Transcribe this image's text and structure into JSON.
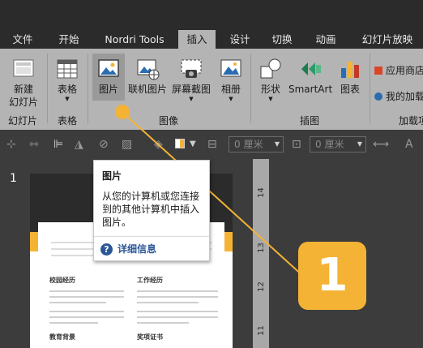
{
  "tabs": [
    {
      "label": "文件"
    },
    {
      "label": "开始"
    },
    {
      "label": "Nordri Tools"
    },
    {
      "label": "插入"
    },
    {
      "label": "设计"
    },
    {
      "label": "切换"
    },
    {
      "label": "动画"
    },
    {
      "label": "幻灯片放映"
    }
  ],
  "ribbon": {
    "new_slide_line1": "新建",
    "new_slide_line2": "幻灯片",
    "table": "表格",
    "picture": "图片",
    "online_picture": "联机图片",
    "screenshot": "屏幕截图",
    "album": "相册",
    "shape": "形状",
    "smartart": "SmartArt",
    "chart": "图表",
    "store": "应用商店",
    "my_addins": "我的加载项"
  },
  "groups": {
    "slides": "幻灯片",
    "tables": "表格",
    "images": "图像",
    "illustrations": "插图",
    "addins": "加载项"
  },
  "format_bar": {
    "width_placeholder": "0 厘米",
    "height_placeholder": "0 厘米"
  },
  "thumbnail": {
    "index": "1"
  },
  "ruler": {
    "labels": [
      "14",
      "13",
      "12",
      "11"
    ]
  },
  "tooltip": {
    "title": "图片",
    "body": "从您的计算机或您连接到的其他计算机中插入图片。",
    "link": "详细信息"
  },
  "slide": {
    "section_education": "校园经历",
    "section_work": "工作经历",
    "section_edu_bg": "教育背景",
    "section_awards": "奖项证书"
  },
  "callout": {
    "number": "1"
  },
  "colors": {
    "accent": "#f4b335",
    "dark": "#2b2b2b",
    "ribbon": "#b4b4b4"
  }
}
